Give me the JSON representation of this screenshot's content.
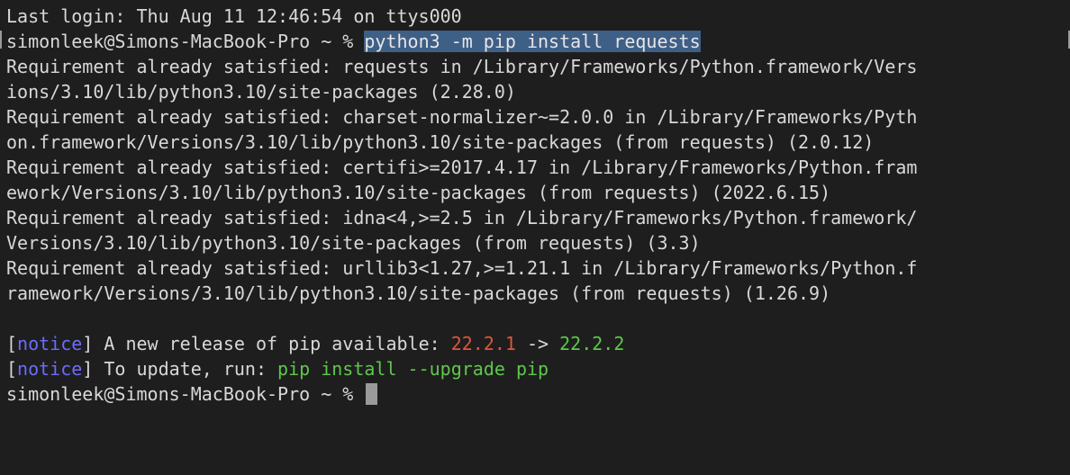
{
  "terminal": {
    "last_login": "Last login: Thu Aug 11 12:46:54 on ttys000",
    "prompt": "simonleek@Simons-MacBook-Pro ~ % ",
    "command": "python3 -m pip install requests",
    "output": [
      "Requirement already satisfied: requests in /Library/Frameworks/Python.framework/Vers",
      "ions/3.10/lib/python3.10/site-packages (2.28.0)",
      "Requirement already satisfied: charset-normalizer~=2.0.0 in /Library/Frameworks/Pyth",
      "on.framework/Versions/3.10/lib/python3.10/site-packages (from requests) (2.0.12)",
      "Requirement already satisfied: certifi>=2017.4.17 in /Library/Frameworks/Python.fram",
      "ework/Versions/3.10/lib/python3.10/site-packages (from requests) (2022.6.15)",
      "Requirement already satisfied: idna<4,>=2.5 in /Library/Frameworks/Python.framework/",
      "Versions/3.10/lib/python3.10/site-packages (from requests) (3.3)",
      "Requirement already satisfied: urllib3<1.27,>=1.21.1 in /Library/Frameworks/Python.f",
      "ramework/Versions/3.10/lib/python3.10/site-packages (from requests) (1.26.9)"
    ],
    "notice1": {
      "bracket_open": "[",
      "tag": "notice",
      "bracket_close": "]",
      "text": " A new release of pip available: ",
      "old_version": "22.2.1",
      "arrow": " -> ",
      "new_version": "22.2.2"
    },
    "notice2": {
      "bracket_open": "[",
      "tag": "notice",
      "bracket_close": "]",
      "text": " To update, run: ",
      "command": "pip install --upgrade pip"
    },
    "final_prompt": "simonleek@Simons-MacBook-Pro ~ % "
  },
  "colors": {
    "background": "#1e1e1e",
    "text": "#d8d8d8",
    "selection": "#3e5f86",
    "notice": "#6b6bff",
    "old_version": "#e0553b",
    "new_version": "#5ec84a"
  }
}
